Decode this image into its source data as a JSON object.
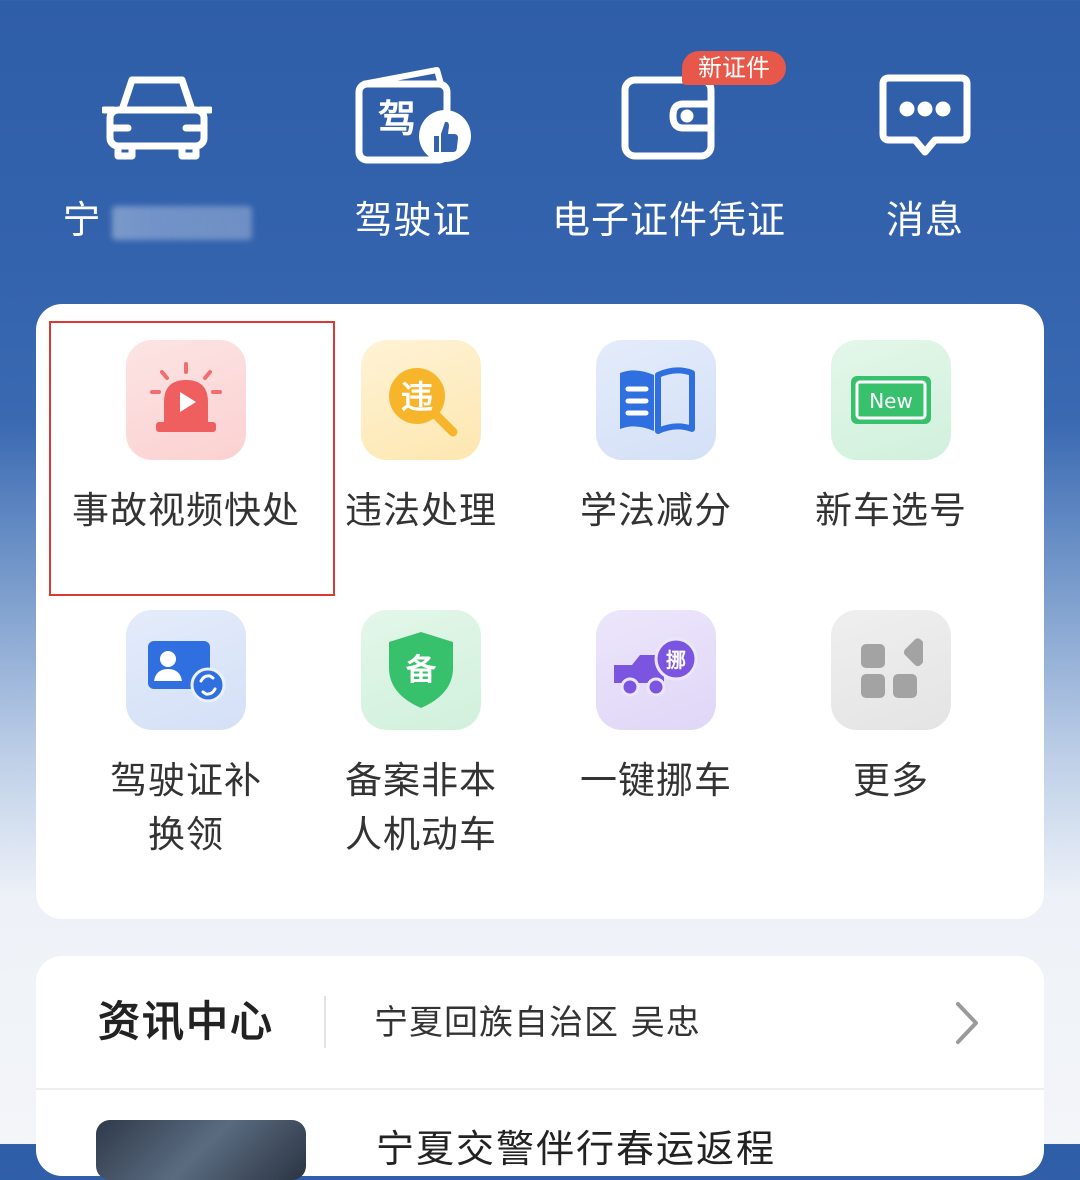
{
  "top": {
    "items": [
      {
        "label": "宁",
        "icon": "car-icon"
      },
      {
        "label": "驾驶证",
        "icon": "driver-license-icon"
      },
      {
        "label": "电子证件凭证",
        "icon": "wallet-icon",
        "badge": "新证件"
      },
      {
        "label": "消息",
        "icon": "message-icon"
      }
    ],
    "license_icon_char": "驾"
  },
  "services": {
    "items": [
      {
        "label": "事故视频快处",
        "icon": "alarm-video-icon",
        "highlighted": true
      },
      {
        "label": "违法处理",
        "icon": "violation-search-icon",
        "icon_char": "违"
      },
      {
        "label": "学法减分",
        "icon": "book-icon"
      },
      {
        "label": "新车选号",
        "icon": "new-plate-icon",
        "icon_text": "New"
      },
      {
        "label": "驾驶证补换领",
        "icon": "license-exchange-icon"
      },
      {
        "label": "备案非本人机动车",
        "icon": "shield-record-icon",
        "icon_char": "备"
      },
      {
        "label": "一键挪车",
        "icon": "move-truck-icon",
        "icon_char": "挪"
      },
      {
        "label": "更多",
        "icon": "more-grid-icon"
      }
    ]
  },
  "news": {
    "title": "资讯中心",
    "ticker": "宁夏回族自治区 吴忠",
    "headline": "宁夏交警伴行春运返程"
  },
  "colors": {
    "header_blue": "#2f5ea8",
    "highlight_red": "#d83a34",
    "badge_red": "#e8584a"
  }
}
